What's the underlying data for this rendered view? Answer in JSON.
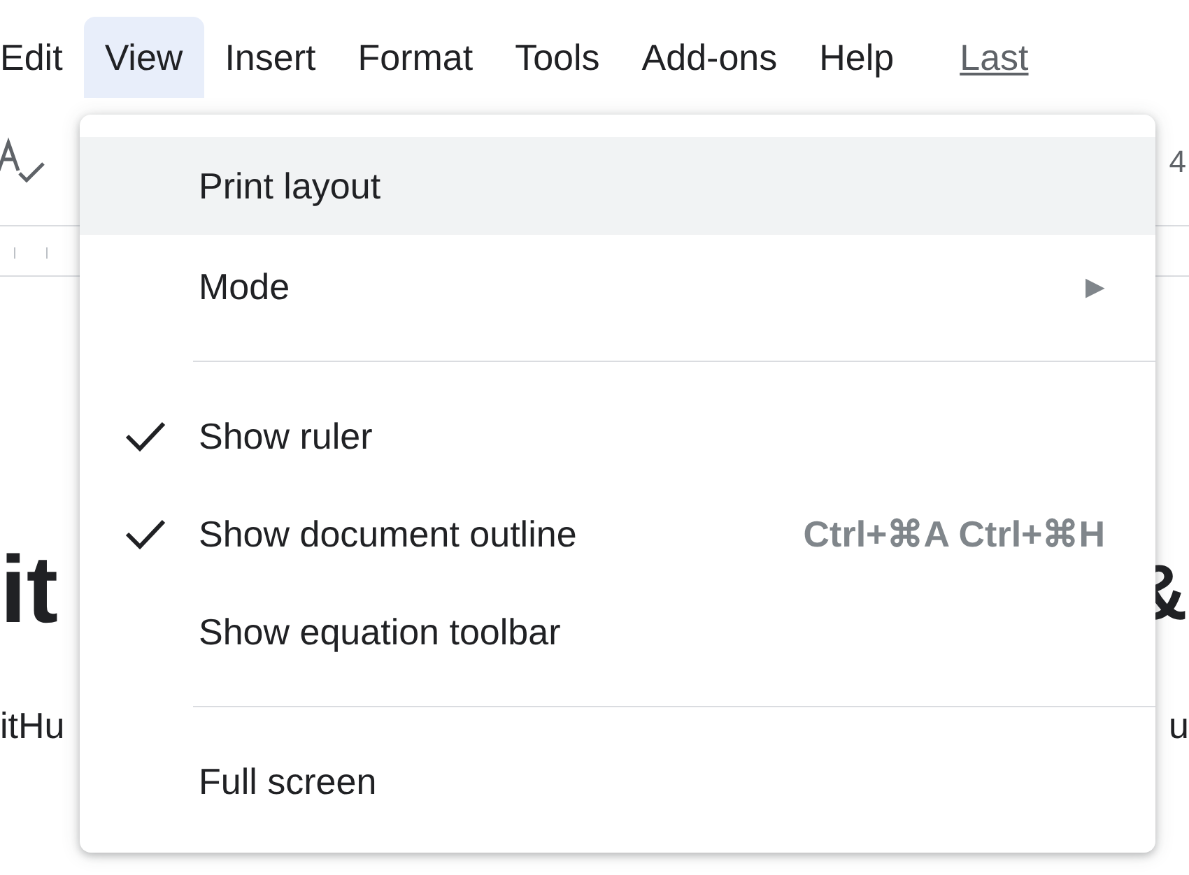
{
  "menubar": [
    {
      "label": "Edit",
      "selected": false
    },
    {
      "label": "View",
      "selected": true
    },
    {
      "label": "Insert",
      "selected": false
    },
    {
      "label": "Format",
      "selected": false
    },
    {
      "label": "Tools",
      "selected": false
    },
    {
      "label": "Add-ons",
      "selected": false
    },
    {
      "label": "Help",
      "selected": false
    }
  ],
  "last_edit_link": "Last",
  "toolbar": {
    "zoom_fragment": "4"
  },
  "document": {
    "heading_left": "it",
    "heading_right": "&",
    "body_left": "itHu",
    "body_right": "u"
  },
  "view_menu": [
    {
      "kind": "item",
      "label": "Print layout",
      "highlighted": true,
      "checked": false
    },
    {
      "kind": "submenu",
      "label": "Mode",
      "submenu_arrow": "▶",
      "highlighted": false,
      "checked": false
    },
    {
      "kind": "separator"
    },
    {
      "kind": "item",
      "label": "Show ruler",
      "highlighted": false,
      "checked": true
    },
    {
      "kind": "item",
      "label": "Show document outline",
      "shortcut": "Ctrl+⌘A Ctrl+⌘H",
      "highlighted": false,
      "checked": true
    },
    {
      "kind": "item",
      "label": "Show equation toolbar",
      "highlighted": false,
      "checked": false
    },
    {
      "kind": "separator"
    },
    {
      "kind": "item",
      "label": "Full screen",
      "highlighted": false,
      "checked": false
    }
  ]
}
